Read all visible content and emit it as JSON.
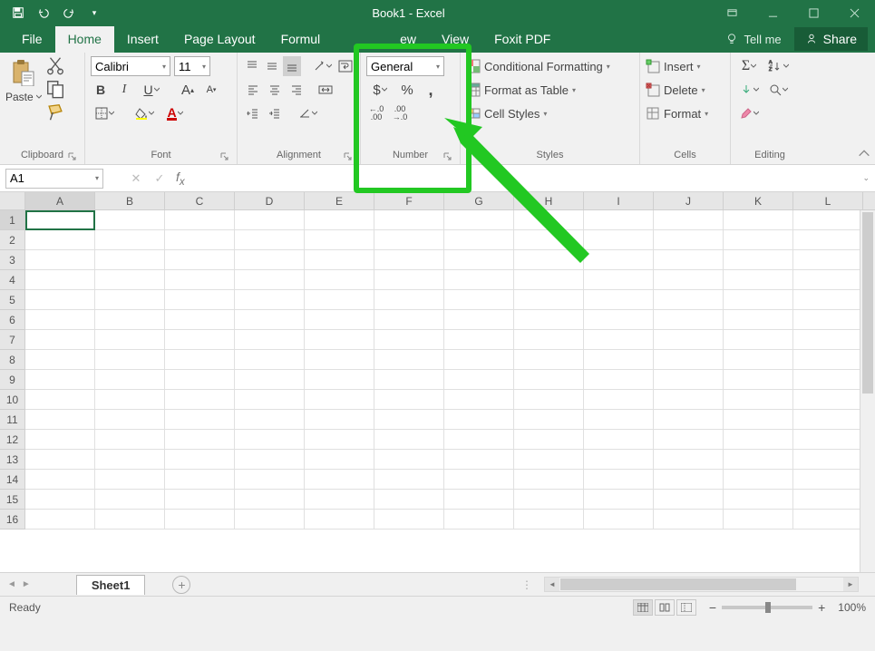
{
  "title": "Book1 - Excel",
  "tabs": [
    "File",
    "Home",
    "Insert",
    "Page Layout",
    "Formul",
    "",
    "ew",
    "View",
    "Foxit PDF"
  ],
  "active_tab": "Home",
  "tellme": "Tell me",
  "share": "Share",
  "clipboard": {
    "paste": "Paste",
    "label": "Clipboard"
  },
  "font": {
    "name": "Calibri",
    "size": "11",
    "label": "Font",
    "bold": "B",
    "italic": "I",
    "underline": "U",
    "growA": "A",
    "shrinkA": "A"
  },
  "alignment": {
    "label": "Alignment"
  },
  "number": {
    "format": "General",
    "label": "Number",
    "currency": "$",
    "percent": "%",
    "comma": ",",
    "inc": "←.0\n.00",
    "dec": ".00\n→.0"
  },
  "styles": {
    "cond": "Conditional Formatting",
    "fat": "Format as Table",
    "cell": "Cell Styles",
    "label": "Styles"
  },
  "cells": {
    "insert": "Insert",
    "delete": "Delete",
    "format": "Format",
    "label": "Cells"
  },
  "editing": {
    "label": "Editing"
  },
  "namebox": "A1",
  "cols": [
    "A",
    "B",
    "C",
    "D",
    "E",
    "F",
    "G",
    "H",
    "I",
    "J",
    "K",
    "L"
  ],
  "rows": 16,
  "sheet": "Sheet1",
  "status": "Ready",
  "zoom": "100%"
}
